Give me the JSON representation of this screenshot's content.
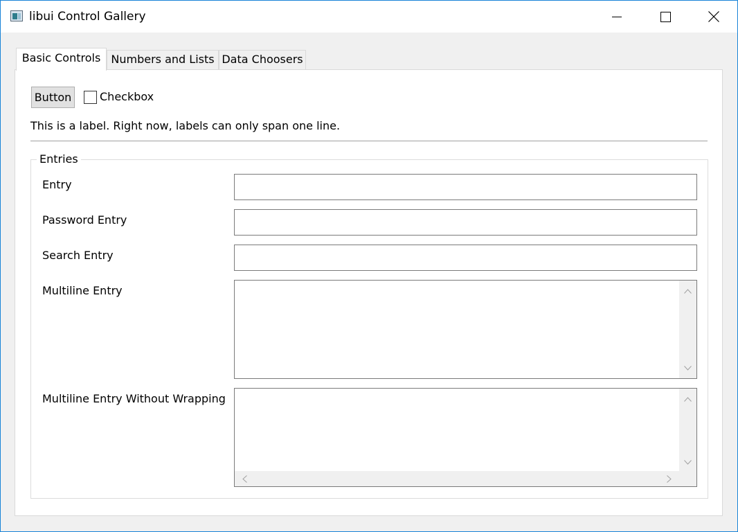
{
  "window": {
    "title": "libui Control Gallery",
    "icon": "app-icon",
    "controls": [
      "minimize-icon",
      "maximize-icon",
      "close-icon"
    ]
  },
  "tabs": [
    {
      "label": "Basic Controls",
      "active": true
    },
    {
      "label": "Numbers and Lists",
      "active": false
    },
    {
      "label": "Data Choosers",
      "active": false
    }
  ],
  "basic": {
    "button_label": "Button",
    "checkbox_label": "Checkbox",
    "checkbox_checked": false,
    "info_label": "This is a label. Right now, labels can only span one line."
  },
  "entries": {
    "group_title": "Entries",
    "rows": [
      {
        "label": "Entry",
        "value": ""
      },
      {
        "label": "Password Entry",
        "value": ""
      },
      {
        "label": "Search Entry",
        "value": ""
      },
      {
        "label": "Multiline Entry",
        "value": ""
      },
      {
        "label": "Multiline Entry Without Wrapping",
        "value": ""
      }
    ]
  },
  "colors": {
    "window_bg": "#f0f0f0",
    "panel_bg": "#ffffff",
    "border": "#7a7a7a",
    "accent": "#1883d7"
  }
}
